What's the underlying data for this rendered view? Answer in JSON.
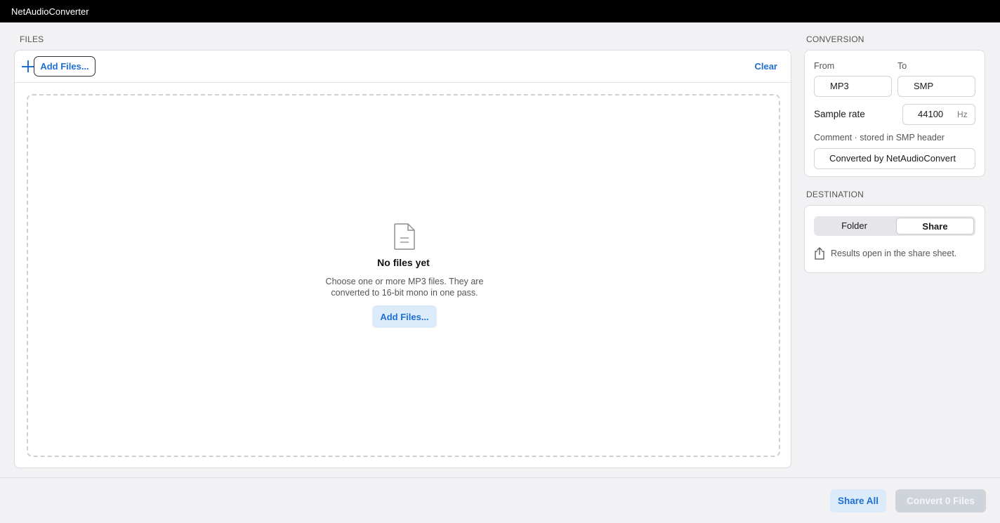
{
  "app": {
    "title": "NetAudioConverter"
  },
  "files": {
    "section_label": "FILES",
    "add_files_label": "Add Files...",
    "clear_label": "Clear",
    "empty_title": "No files yet",
    "empty_description": "Choose one or more MP3 files. They are converted to 16-bit mono in one pass.",
    "empty_add_files_label": "Add Files..."
  },
  "conversion": {
    "section_label": "CONVERSION",
    "from_label": "From",
    "from_value": "MP3",
    "to_label": "To",
    "to_value": "SMP",
    "sample_rate_label": "Sample rate",
    "sample_rate_value": "44100",
    "sample_rate_unit": "Hz",
    "comment_label": "Comment · stored in SMP header",
    "comment_value": "Converted by NetAudioConvert"
  },
  "destination": {
    "section_label": "DESTINATION",
    "options": [
      "Folder",
      "Share"
    ],
    "selected": "Share",
    "note": "Results open in the share sheet."
  },
  "footer": {
    "share_all_label": "Share All",
    "convert_label": "Convert 0 Files"
  },
  "colors": {
    "accent": "#1f6fd1",
    "tinted_bg": "#dcebfa",
    "titlebar_bg": "#000000",
    "disabled_bg": "#cfd4da"
  },
  "icons": [
    "plus-icon",
    "document-icon",
    "share-icon"
  ]
}
